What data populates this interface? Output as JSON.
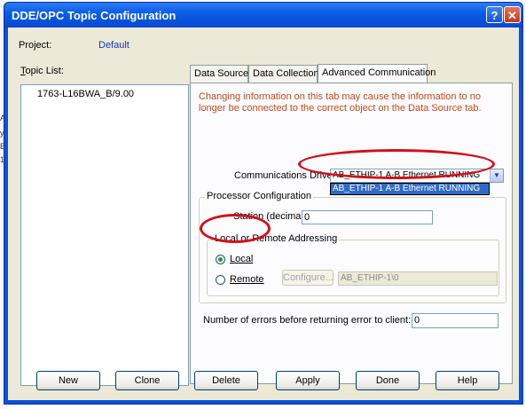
{
  "window": {
    "title": "DDE/OPC Topic Configuration",
    "help_glyph": "?",
    "close_glyph": "✕"
  },
  "project": {
    "label": "Project:",
    "value": "Default"
  },
  "topic_list": {
    "label": "Topic List:",
    "items": [
      "1763-L16BWA_B/9.00"
    ]
  },
  "tabs": [
    {
      "label": "Data Source",
      "active": false
    },
    {
      "label": "Data Collection",
      "active": false
    },
    {
      "label": "Advanced Communication",
      "active": true
    }
  ],
  "advanced": {
    "warning": "Changing information on this tab may cause the information to no longer be connected to the correct object on the Data Source tab.",
    "driver_label": "Communications Driver:",
    "driver_value": "AB_ETHIP-1  A-B Ethernet  RUNNING",
    "driver_option": "AB_ETHIP-1  A-B Ethernet  RUNNING",
    "processor_group": "Processor Configuration",
    "station_label": "Station (decimal):",
    "station_value": "0",
    "addressing_group": "Local or Remote Addressing",
    "local_label": "Local",
    "remote_label": "Remote",
    "selected_addressing": "Local",
    "configure_label": "Configure...",
    "remote_path": "AB_ETHIP-1\\0",
    "errors_label": "Number of errors before returning error to client:",
    "errors_value": "0"
  },
  "buttons": {
    "new": "New",
    "clone": "Clone",
    "delete": "Delete",
    "apply": "Apply",
    "done": "Done",
    "help": "Help"
  },
  "colors": {
    "titlebar": "#0a5fe6",
    "warning_text": "#c2491b",
    "highlight": "#316ac5",
    "annotation_red": "#d0101c"
  }
}
